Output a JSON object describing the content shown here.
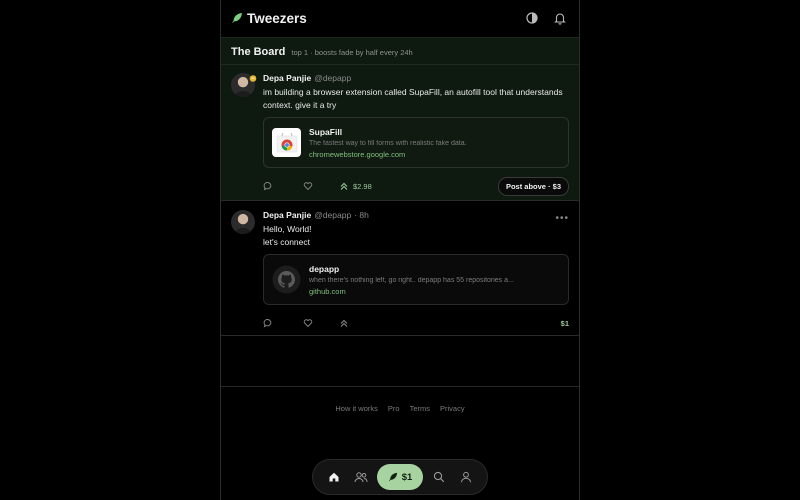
{
  "header": {
    "app_title": "Tweezers"
  },
  "board": {
    "title": "The Board",
    "subtitle": "top 1 · boosts fade by half every 24h",
    "post": {
      "author_name": "Depa Panjie",
      "author_handle": "@depapp",
      "text": "im building a browser extension called SupaFill, an autofill tool that understands context. give it a try",
      "link": {
        "title": "SupaFill",
        "description": "The fastest way to fill forms with realistic fake data.",
        "domain": "chromewebstore.google.com"
      },
      "boost_amount": "$2.98",
      "post_above_label": "Post above · $3"
    }
  },
  "feed": [
    {
      "author_name": "Depa Panjie",
      "author_handle": "@depapp",
      "time": "· 8h",
      "text": "Hello, World!\nlet's connect",
      "link": {
        "title": "depapp",
        "description": "when there's nothing left, go right.. depapp has 55 repositories a...",
        "domain": "github.com"
      },
      "price": "$1"
    }
  ],
  "footer": {
    "links": [
      "How it works",
      "Pro",
      "Terms",
      "Privacy"
    ]
  },
  "bottom_nav": {
    "fab_label": "$1"
  },
  "colors": {
    "accent": "#a7d3a0",
    "board_bg": "#0e1a0f",
    "link_domain": "#7fbf7f"
  }
}
